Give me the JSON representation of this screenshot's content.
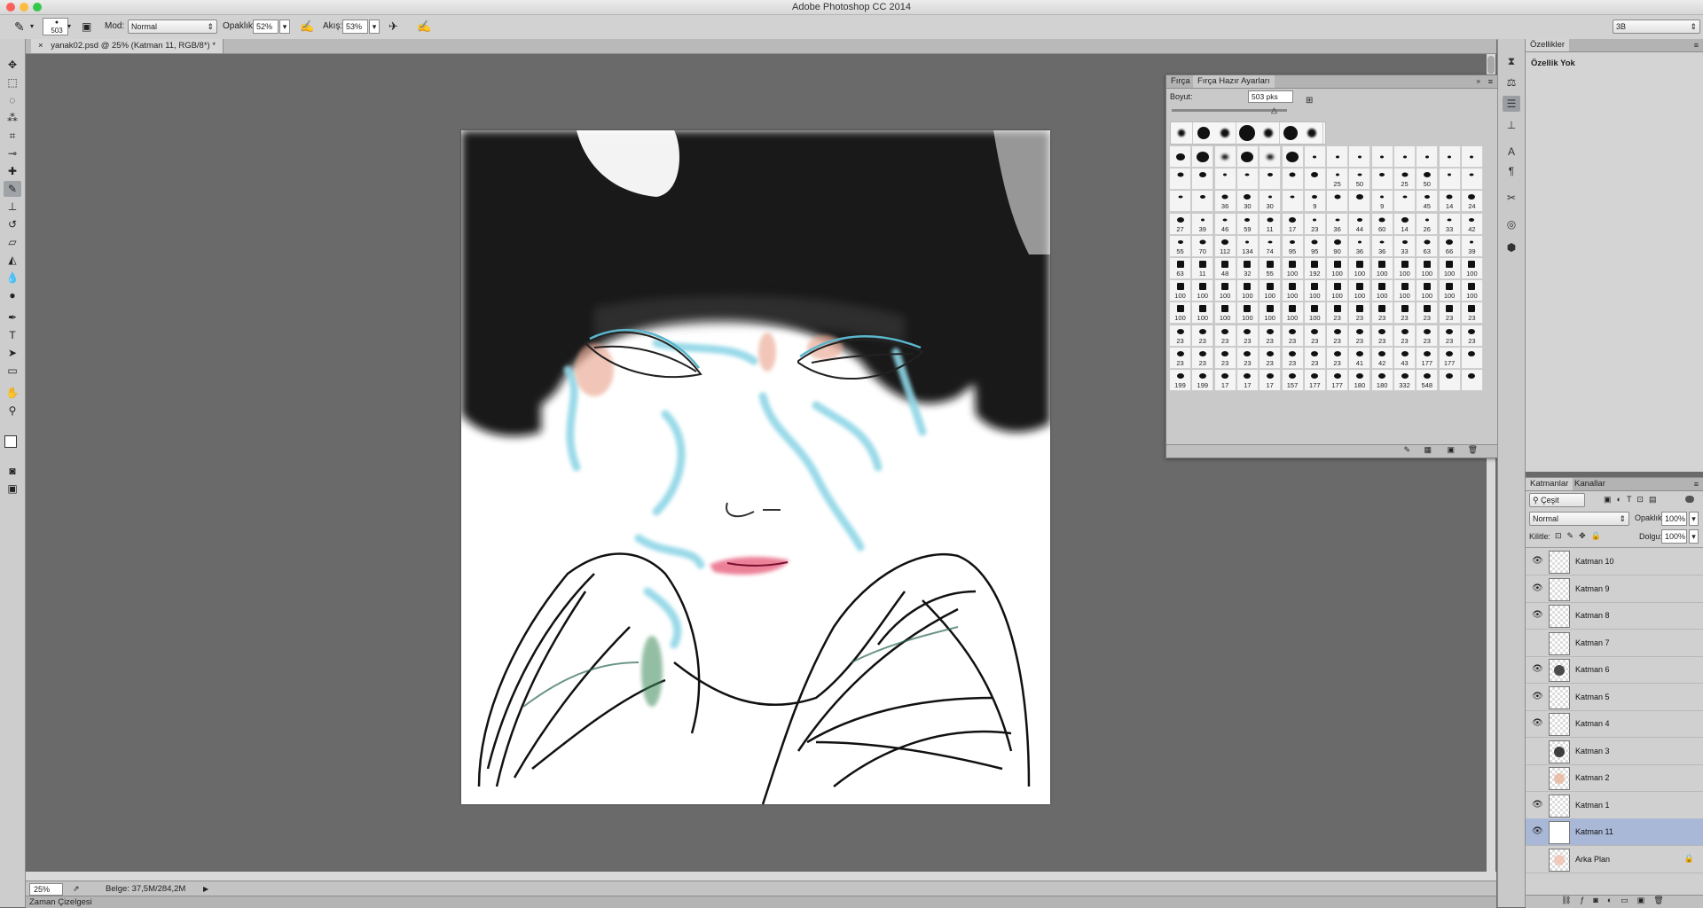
{
  "window": {
    "title": "Adobe Photoshop CC 2014"
  },
  "options_bar": {
    "brush_size": "503",
    "mode_label": "Mod:",
    "mode_value": "Normal",
    "opacity_label": "Opaklık:",
    "opacity_value": "52%",
    "flow_label": "Akış:",
    "flow_value": "53%",
    "workspace_value": "3B"
  },
  "document": {
    "tab_title": "yanak02.psd @ 25% (Katman 11, RGB/8*) *"
  },
  "status": {
    "zoom": "25%",
    "doc_info": "Belge: 37,5M/284,2M"
  },
  "timeline": {
    "label": "Zaman Çizelgesi"
  },
  "brush_panel": {
    "tab_brush": "Fırça",
    "tab_presets": "Fırça Hazır Ayarları",
    "size_label": "Boyut:",
    "size_value": "503 pks",
    "rows": [
      [
        "",
        "",
        "",
        "",
        "",
        "",
        "",
        "",
        "",
        "",
        "",
        "",
        "",
        ""
      ],
      [
        "",
        "",
        "",
        "",
        "",
        "",
        "",
        "25",
        "50",
        "",
        "25",
        "50",
        "",
        ""
      ],
      [
        "",
        "",
        "36",
        "30",
        "30",
        "",
        "9",
        "",
        "",
        "9",
        "",
        "45",
        "14",
        "24"
      ],
      [
        "27",
        "39",
        "46",
        "59",
        "11",
        "17",
        "23",
        "36",
        "44",
        "60",
        "14",
        "26",
        "33",
        "42"
      ],
      [
        "55",
        "70",
        "112",
        "134",
        "74",
        "95",
        "95",
        "90",
        "36",
        "36",
        "33",
        "63",
        "66",
        "39"
      ],
      [
        "63",
        "11",
        "48",
        "32",
        "55",
        "100",
        "192",
        "100",
        "100",
        "100",
        "100",
        "100",
        "100",
        "100"
      ],
      [
        "100",
        "100",
        "100",
        "100",
        "100",
        "100",
        "100",
        "100",
        "100",
        "100",
        "100",
        "100",
        "100",
        "100"
      ],
      [
        "100",
        "100",
        "100",
        "100",
        "100",
        "100",
        "100",
        "23",
        "23",
        "23",
        "23",
        "23",
        "23",
        "23"
      ],
      [
        "23",
        "23",
        "23",
        "23",
        "23",
        "23",
        "23",
        "23",
        "23",
        "23",
        "23",
        "23",
        "23",
        "23"
      ],
      [
        "23",
        "23",
        "23",
        "23",
        "23",
        "23",
        "23",
        "23",
        "41",
        "42",
        "43",
        "177",
        "177",
        ""
      ],
      [
        "199",
        "199",
        "17",
        "17",
        "17",
        "157",
        "177",
        "177",
        "180",
        "180",
        "332",
        "548",
        "",
        ""
      ]
    ]
  },
  "properties_panel": {
    "tab": "Özellikler",
    "empty_text": "Özellik Yok"
  },
  "layers_panel": {
    "tab_layers": "Katmanlar",
    "tab_channels": "Kanallar",
    "filter_value": "Çeşit",
    "blend_value": "Normal",
    "opacity_label": "Opaklık:",
    "opacity_value": "100%",
    "lock_label": "Kilitle:",
    "fill_label": "Dolgu:",
    "fill_value": "100%",
    "layers": [
      {
        "name": "Katman 10",
        "visible": true
      },
      {
        "name": "Katman 9",
        "visible": true
      },
      {
        "name": "Katman 8",
        "visible": true
      },
      {
        "name": "Katman 7",
        "visible": false
      },
      {
        "name": "Katman 6",
        "visible": true
      },
      {
        "name": "Katman 5",
        "visible": true
      },
      {
        "name": "Katman 4",
        "visible": true
      },
      {
        "name": "Katman 3",
        "visible": false
      },
      {
        "name": "Katman 2",
        "visible": false
      },
      {
        "name": "Katman 1",
        "visible": true
      },
      {
        "name": "Katman 11",
        "visible": true,
        "selected": true
      },
      {
        "name": "Arka Plan",
        "visible": false,
        "locked": true
      }
    ]
  }
}
